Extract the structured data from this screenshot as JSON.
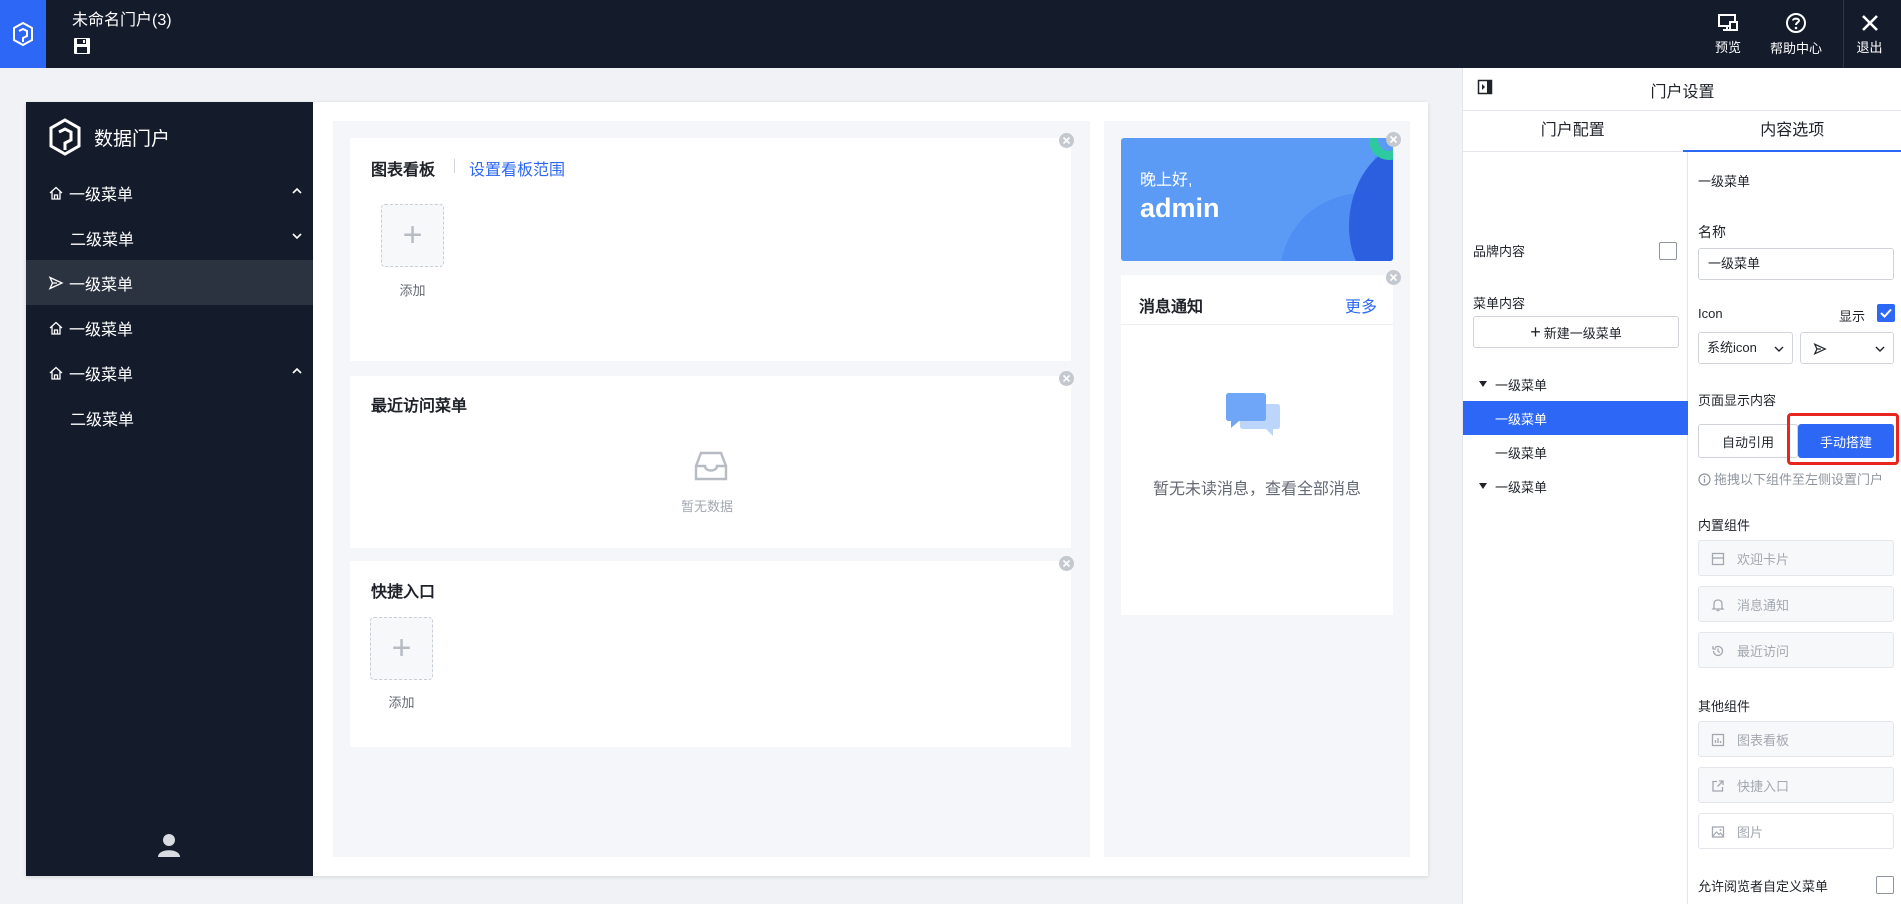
{
  "header": {
    "title": "未命名门户(3)",
    "actions": [
      {
        "label": "预览",
        "icon": "preview-icon"
      },
      {
        "label": "帮助中心",
        "icon": "help-icon"
      },
      {
        "label": "退出",
        "icon": "close-icon"
      }
    ]
  },
  "portal": {
    "brand": "数据门户",
    "menu": [
      {
        "label": "一级菜单",
        "icon": "home-icon",
        "level": 1,
        "chevron": "up",
        "active": false
      },
      {
        "label": "二级菜单",
        "level": 2,
        "chevron": "down",
        "active": false
      },
      {
        "label": "一级菜单",
        "icon": "send-icon",
        "level": 1,
        "active": true
      },
      {
        "label": "一级菜单",
        "icon": "home-icon",
        "level": 1,
        "active": false
      },
      {
        "label": "一级菜单",
        "icon": "home-icon",
        "level": 1,
        "chevron": "up",
        "active": false
      },
      {
        "label": "二级菜单",
        "level": 2,
        "active": false
      }
    ],
    "dashboard": {
      "title": "图表看板",
      "link": "设置看板范围",
      "add_label": "添加"
    },
    "recent": {
      "title": "最近访问菜单",
      "empty": "暂无数据"
    },
    "shortcut": {
      "title": "快捷入口",
      "add_label": "添加"
    },
    "welcome": {
      "greeting": "晚上好,",
      "name": "admin"
    },
    "notice": {
      "title": "消息通知",
      "more": "更多",
      "empty": "暂无未读消息，查看全部消息"
    }
  },
  "panel": {
    "title": "门户设置",
    "tabs": [
      {
        "label": "门户配置",
        "active": false
      },
      {
        "label": "内容选项",
        "active": true
      }
    ],
    "brand_label": "品牌内容",
    "brand_checked": false,
    "menu_content_label": "菜单内容",
    "new_menu_button": "新建一级菜单",
    "tree": [
      {
        "label": "一级菜单",
        "caret": true,
        "selected": false
      },
      {
        "label": "一级菜单",
        "caret": false,
        "selected": true
      },
      {
        "label": "一级菜单",
        "caret": false,
        "selected": false
      },
      {
        "label": "一级菜单",
        "caret": true,
        "selected": false
      }
    ],
    "detail": {
      "heading": "一级菜单",
      "name_label": "名称",
      "name_value": "一级菜单",
      "icon_label": "Icon",
      "show_label": "显示",
      "show_checked": true,
      "icon_type": "系统icon",
      "page_content_label": "页面显示内容",
      "auto_ref": "自动引用",
      "manual_build": "手动搭建",
      "hint": "拖拽以下组件至左侧设置门户",
      "builtin_label": "内置组件",
      "builtin": [
        {
          "label": "欢迎卡片",
          "icon": "card-icon"
        },
        {
          "label": "消息通知",
          "icon": "bell-icon"
        },
        {
          "label": "最近访问",
          "icon": "history-icon"
        }
      ],
      "other_label": "其他组件",
      "other": [
        {
          "label": "图表看板",
          "icon": "chart-icon"
        },
        {
          "label": "快捷入口",
          "icon": "external-link-icon"
        },
        {
          "label": "图片",
          "icon": "image-icon"
        }
      ],
      "allow_custom_label": "允许阅览者自定义菜单",
      "allow_custom_checked": false
    }
  },
  "colors": {
    "dark": "#141b2b",
    "accent": "#2d67f6",
    "highlight": "#e8261f"
  }
}
